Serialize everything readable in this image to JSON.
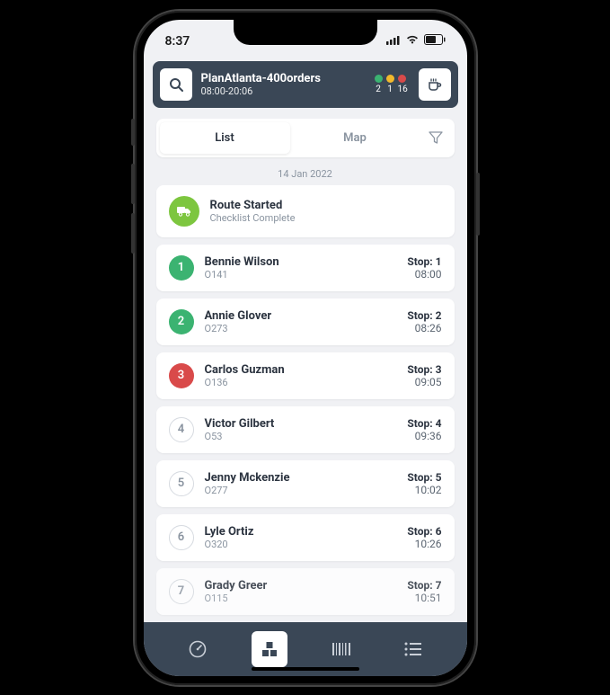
{
  "statusbar": {
    "time": "8:37"
  },
  "header": {
    "title": "PlanAtlanta-400orders",
    "subtitle": "08:00-20:06",
    "counts": {
      "green": "2",
      "yellow": "1",
      "red": "16"
    }
  },
  "tabs": {
    "list": "List",
    "map": "Map"
  },
  "date": "14 Jan 2022",
  "route": {
    "title": "Route Started",
    "subtitle": "Checklist Complete"
  },
  "stop_label": "Stop:",
  "stops": [
    {
      "num": "1",
      "name": "Bennie Wilson",
      "code": "O141",
      "stop": "1",
      "time": "08:00",
      "color": "green"
    },
    {
      "num": "2",
      "name": "Annie Glover",
      "code": "O273",
      "stop": "2",
      "time": "08:26",
      "color": "green"
    },
    {
      "num": "3",
      "name": "Carlos Guzman",
      "code": "O136",
      "stop": "3",
      "time": "09:05",
      "color": "red"
    },
    {
      "num": "4",
      "name": "Victor Gilbert",
      "code": "O53",
      "stop": "4",
      "time": "09:36",
      "color": "grey"
    },
    {
      "num": "5",
      "name": "Jenny Mckenzie",
      "code": "O277",
      "stop": "5",
      "time": "10:02",
      "color": "grey"
    },
    {
      "num": "6",
      "name": "Lyle Ortiz",
      "code": "O320",
      "stop": "6",
      "time": "10:26",
      "color": "grey"
    },
    {
      "num": "7",
      "name": "Grady Greer",
      "code": "O115",
      "stop": "7",
      "time": "10:51",
      "color": "grey"
    }
  ],
  "colors": {
    "green": "#3bb371",
    "yellow": "#f2b92c",
    "red": "#d94a4a",
    "lime": "#7dc63f",
    "navy": "#3a4756"
  }
}
